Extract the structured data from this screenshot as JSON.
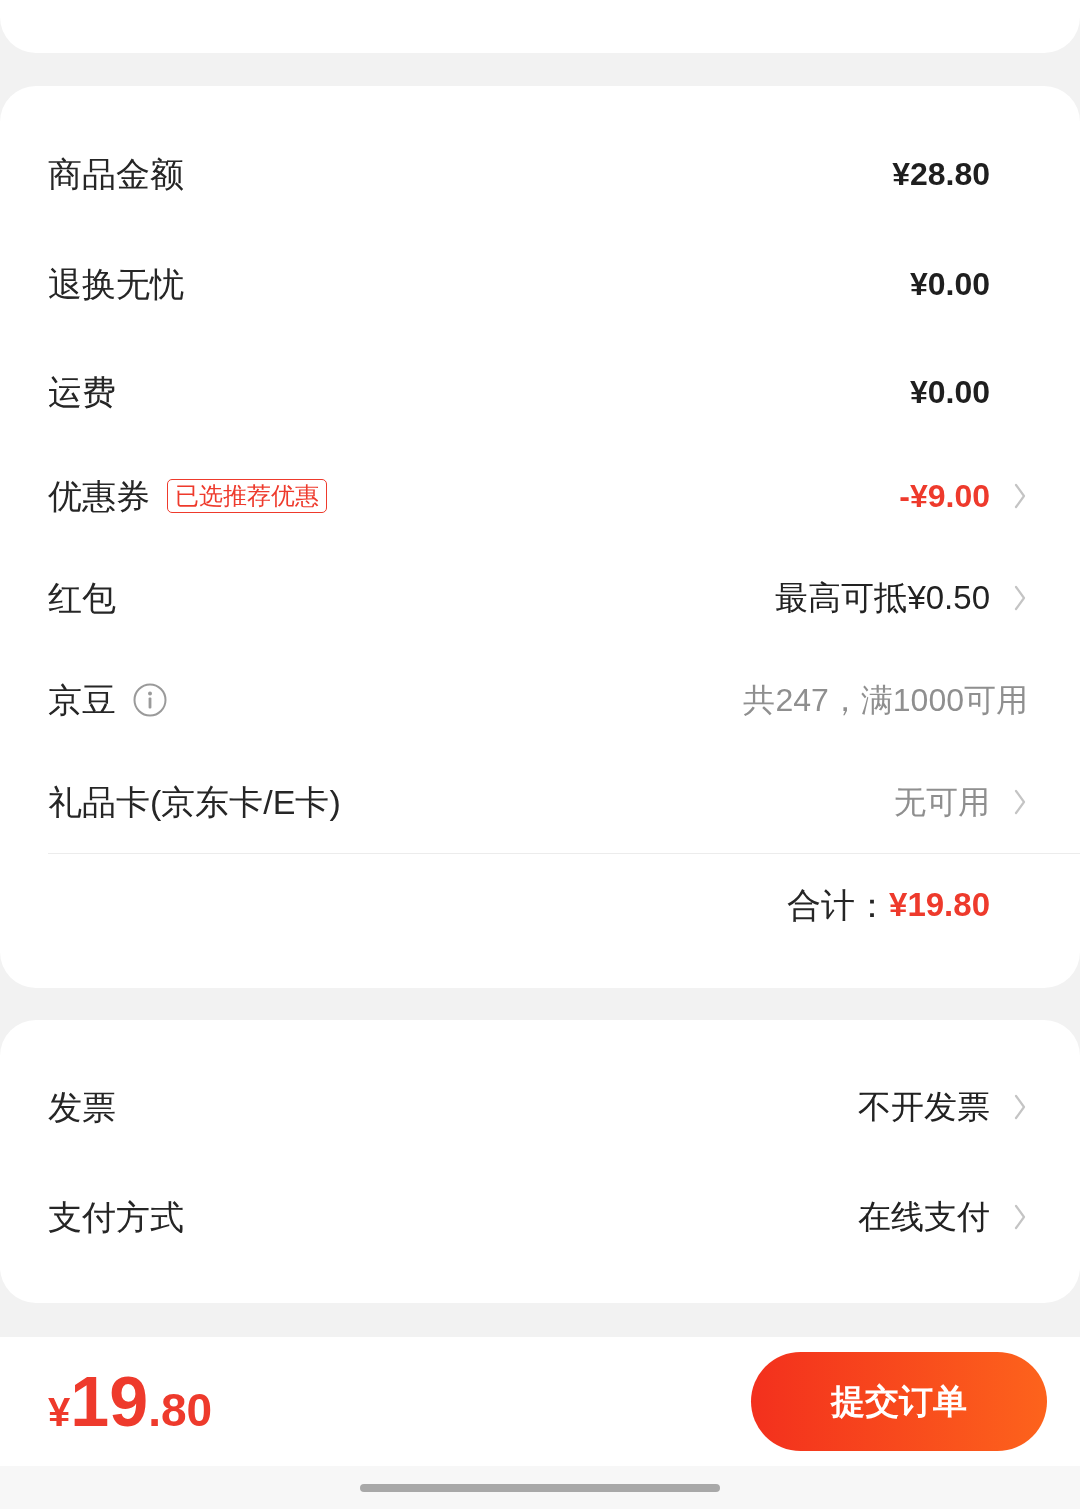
{
  "summary": {
    "rows": [
      {
        "label": "商品金额",
        "value": "¥28.80",
        "kind": "amount",
        "arrow": false
      },
      {
        "label": "退换无忧",
        "value": "¥0.00",
        "kind": "amount",
        "arrow": false
      },
      {
        "label": "运费",
        "value": "¥0.00",
        "kind": "amount",
        "arrow": false
      },
      {
        "label": "优惠券",
        "tag": "已选推荐优惠",
        "value": "-¥9.00",
        "kind": "discount",
        "arrow": true
      },
      {
        "label": "红包",
        "value": "最高可抵¥0.50",
        "kind": "link",
        "arrow": true
      },
      {
        "label": "京豆",
        "info": true,
        "value": "共247，满1000可用",
        "kind": "note",
        "arrow": false
      },
      {
        "label": "礼品卡(京东卡/E卡)",
        "value": "无可用",
        "kind": "muted",
        "arrow": true
      }
    ],
    "total": {
      "label": "合计：",
      "amount": "¥19.80"
    }
  },
  "options": {
    "rows": [
      {
        "label": "发票",
        "value": "不开发票",
        "kind": "link",
        "arrow": true
      },
      {
        "label": "支付方式",
        "value": "在线支付",
        "kind": "link",
        "arrow": true
      }
    ]
  },
  "bottom_bar": {
    "price": {
      "currency": "¥",
      "integer": "19",
      "decimal": ".80"
    },
    "submit_button": "提交订单"
  }
}
